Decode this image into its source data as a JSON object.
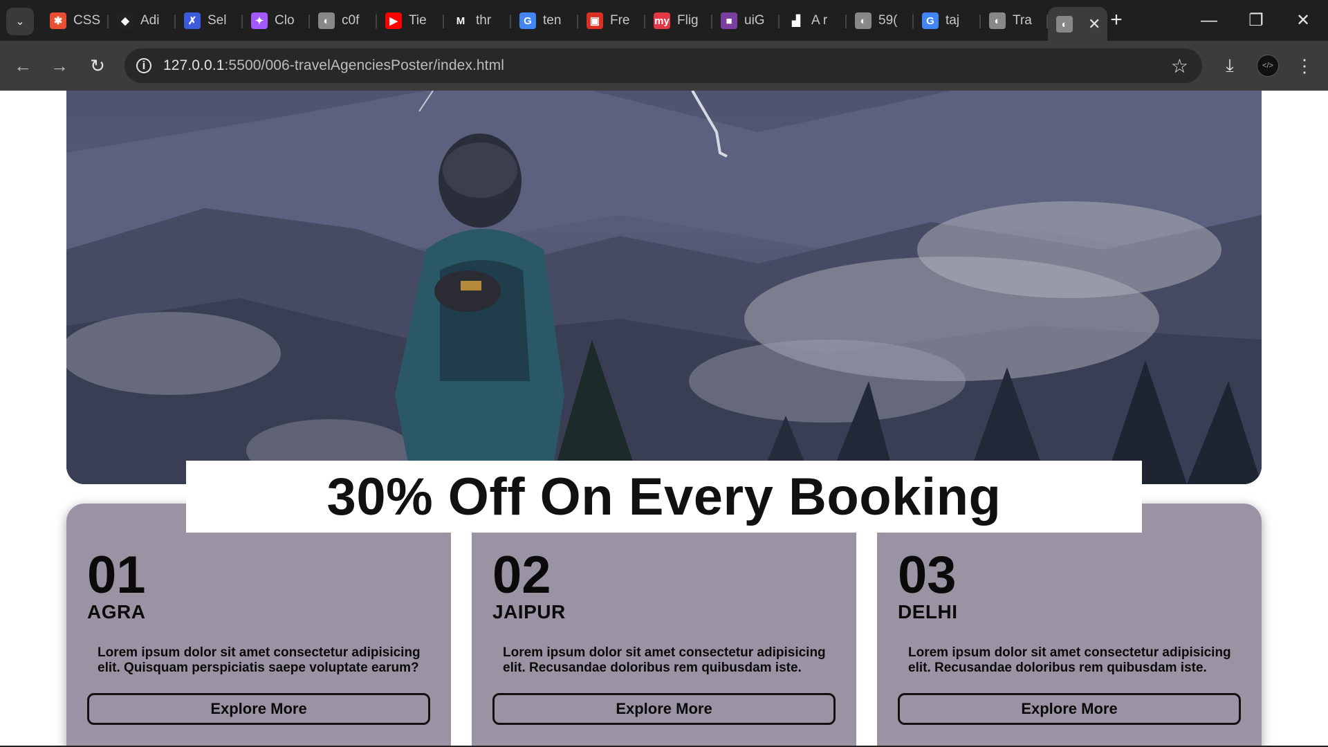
{
  "browser": {
    "tabs": [
      {
        "label": "CSS",
        "favicon_color": "#e84f32",
        "favicon_glyph": "✱"
      },
      {
        "label": "Adi",
        "favicon_color": "#222222",
        "favicon_glyph": "◆"
      },
      {
        "label": "Sel",
        "favicon_color": "#3b5bdb",
        "favicon_glyph": "✗"
      },
      {
        "label": "Clo",
        "favicon_color": "#a259ff",
        "favicon_glyph": "✦"
      },
      {
        "label": "c0f",
        "favicon_color": "#888888",
        "favicon_glyph": "◐"
      },
      {
        "label": "Tie",
        "favicon_color": "#ff0000",
        "favicon_glyph": "▶"
      },
      {
        "label": "thr",
        "favicon_color": "#1f1f1f",
        "favicon_glyph": "M"
      },
      {
        "label": "ten",
        "favicon_color": "#4285f4",
        "favicon_glyph": "G"
      },
      {
        "label": "Fre",
        "favicon_color": "#d93025",
        "favicon_glyph": "▣"
      },
      {
        "label": "Flig",
        "favicon_color": "#e23744",
        "favicon_glyph": "my"
      },
      {
        "label": "uiG",
        "favicon_color": "#7b3fa0",
        "favicon_glyph": "■"
      },
      {
        "label": "A r",
        "favicon_color": "#1f1f1f",
        "favicon_glyph": "▟"
      },
      {
        "label": "59(",
        "favicon_color": "#888888",
        "favicon_glyph": "◐"
      },
      {
        "label": "taj",
        "favicon_color": "#4285f4",
        "favicon_glyph": "G"
      },
      {
        "label": "Tra",
        "favicon_color": "#888888",
        "favicon_glyph": "◐"
      }
    ],
    "active_tab": {
      "favicon_glyph": "◐"
    },
    "address": {
      "host": "127.0.0.1",
      "path": ":5500/006-travelAgenciesPoster/index.html"
    }
  },
  "poster": {
    "headline": "30% Off On Every Booking",
    "cards": [
      {
        "number": "01",
        "city": "AGRA",
        "description": "Lorem ipsum dolor sit amet consectetur adipisicing elit. Quisquam perspiciatis saepe voluptate earum?",
        "button": "Explore More"
      },
      {
        "number": "02",
        "city": "JAIPUR",
        "description": "Lorem ipsum dolor sit amet consectetur adipisicing elit. Recusandae doloribus rem quibusdam iste.",
        "button": "Explore More"
      },
      {
        "number": "03",
        "city": "DELHI",
        "description": "Lorem ipsum dolor sit amet consectetur adipisicing elit. Recusandae doloribus rem quibusdam iste.",
        "button": "Explore More"
      }
    ]
  },
  "colors": {
    "card_bg": "#9a93a3",
    "chrome_dark": "#1f1f1f",
    "toolbar": "#3c3c3c"
  }
}
